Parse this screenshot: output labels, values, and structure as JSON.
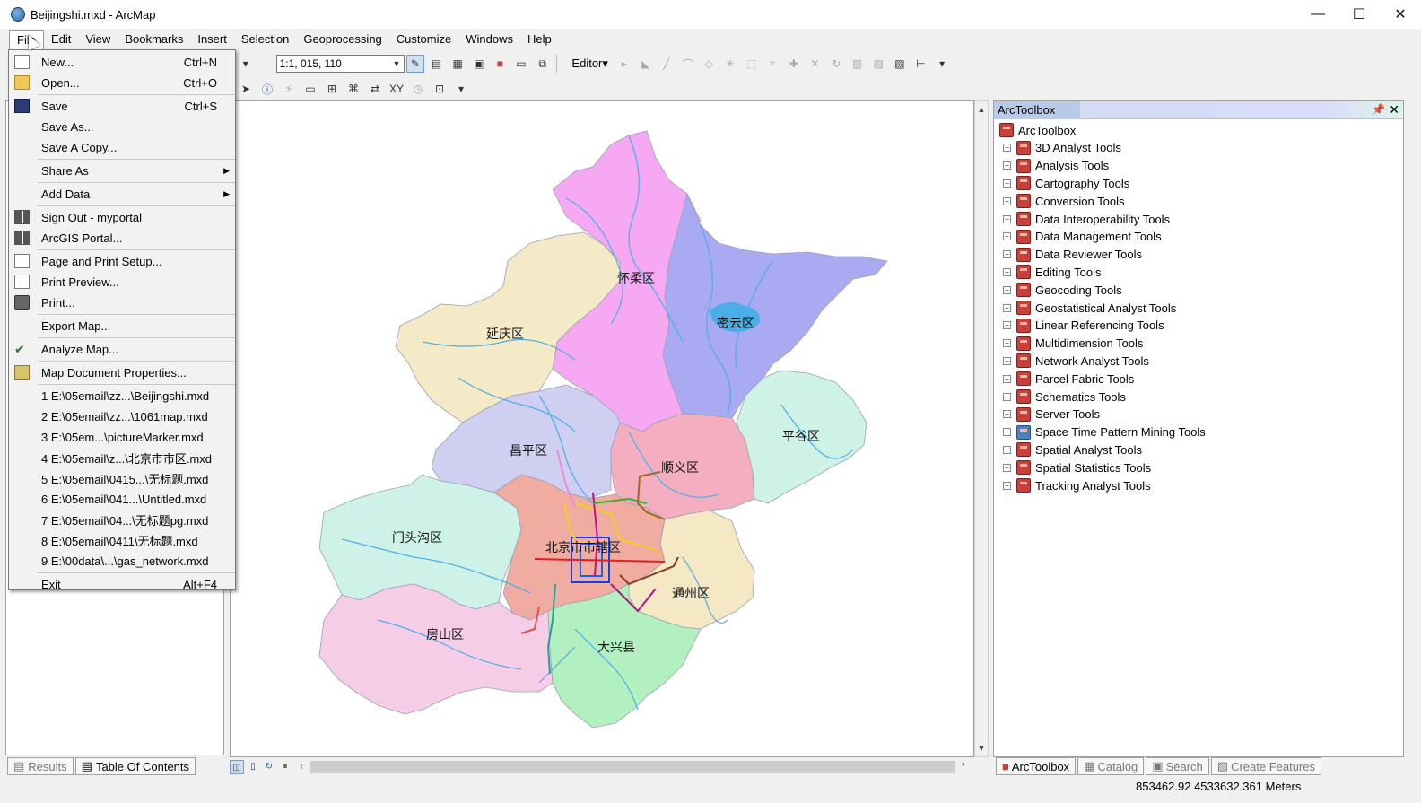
{
  "window": {
    "title": "Beijingshi.mxd - ArcMap",
    "minimize": "—",
    "maximize": "☐",
    "close": "✕"
  },
  "menubar": [
    "File",
    "Edit",
    "View",
    "Bookmarks",
    "Insert",
    "Selection",
    "Geoprocessing",
    "Customize",
    "Windows",
    "Help"
  ],
  "toolbar": {
    "scale": "1:1, 015, 110",
    "editor": "Editor▾"
  },
  "file_menu": {
    "new": "New...",
    "new_sc": "Ctrl+N",
    "open": "Open...",
    "open_sc": "Ctrl+O",
    "save": "Save",
    "save_sc": "Ctrl+S",
    "save_as": "Save As...",
    "save_copy": "Save A Copy...",
    "share_as": "Share As",
    "add_data": "Add Data",
    "sign_out": "Sign Out - myportal",
    "portal": "ArcGIS Portal...",
    "page_setup": "Page and Print Setup...",
    "print_preview": "Print Preview...",
    "print": "Print...",
    "export_map": "Export Map...",
    "analyze_map": "Analyze Map...",
    "doc_props": "Map Document Properties...",
    "recent": [
      "1 E:\\05email\\zz...\\Beijingshi.mxd",
      "2 E:\\05email\\zz...\\1061map.mxd",
      "3 E:\\05em...\\pictureMarker.mxd",
      "4 E:\\05email\\z...\\北京市市区.mxd",
      "5 E:\\05email\\0415...\\无标题.mxd",
      "6 E:\\05email\\041...\\Untitled.mxd",
      "7 E:\\05email\\04...\\无标题pg.mxd",
      "8 E:\\05email\\0411\\无标题.mxd",
      "9 E:\\00data\\...\\gas_network.mxd"
    ],
    "exit": "Exit",
    "exit_sc": "Alt+F4"
  },
  "map": {
    "labels": {
      "huairou": "怀柔区",
      "yanqing": "延庆区",
      "miyun": "密云区",
      "pinggu": "平谷区",
      "changping": "昌平区",
      "shunyi": "顺义区",
      "mentougou": "门头沟区",
      "city": "北京市市辖区",
      "tongzhou": "通州区",
      "fangshan": "房山区",
      "daxing": "大兴县"
    }
  },
  "toolbox": {
    "title": "ArcToolbox",
    "root": "ArcToolbox",
    "tools": [
      "3D Analyst Tools",
      "Analysis Tools",
      "Cartography Tools",
      "Conversion Tools",
      "Data Interoperability Tools",
      "Data Management Tools",
      "Data Reviewer Tools",
      "Editing Tools",
      "Geocoding Tools",
      "Geostatistical Analyst Tools",
      "Linear Referencing Tools",
      "Multidimension Tools",
      "Network Analyst Tools",
      "Parcel Fabric Tools",
      "Schematics Tools",
      "Server Tools",
      "Space Time Pattern Mining Tools",
      "Spatial Analyst Tools",
      "Spatial Statistics Tools",
      "Tracking Analyst Tools"
    ]
  },
  "left_tabs": {
    "results": "Results",
    "toc": "Table Of Contents"
  },
  "right_tabs": {
    "arctoolbox": "ArcToolbox",
    "catalog": "Catalog",
    "search": "Search",
    "create_features": "Create Features"
  },
  "status": {
    "coords": "853462.92  4533632.361 Meters"
  },
  "colors": {
    "huairou": "#f6a9f2",
    "yanqing": "#f5eac7",
    "miyun": "#aaaaf2",
    "pinggu": "#cef3e6",
    "changping": "#cfcff2",
    "shunyi": "#f4aebf",
    "mentougou": "#cff2e8",
    "city": "#f0aca0",
    "tongzhou": "#f5e8c4",
    "fangshan": "#f6cde6",
    "daxing": "#b2f0c0",
    "river": "#4aaee8"
  }
}
